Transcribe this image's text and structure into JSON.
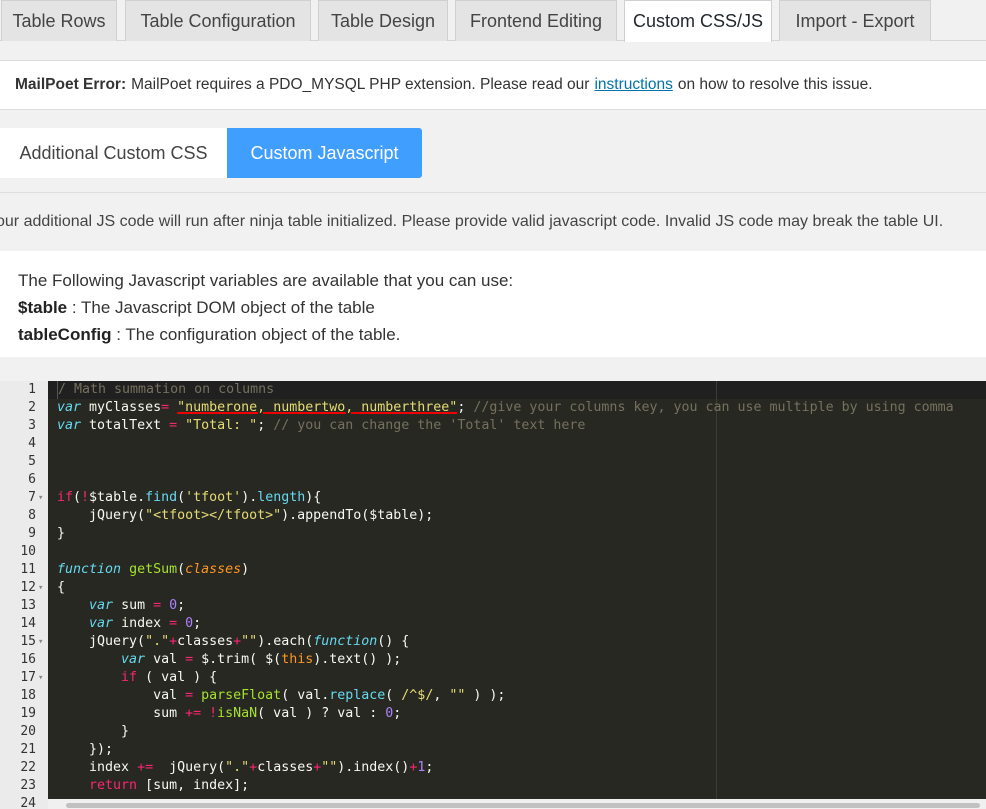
{
  "tabs": [
    {
      "label": "Table Rows",
      "active": false
    },
    {
      "label": "Table Configuration",
      "active": false
    },
    {
      "label": "Table Design",
      "active": false
    },
    {
      "label": "Frontend Editing",
      "active": false
    },
    {
      "label": "Custom CSS/JS",
      "active": true
    },
    {
      "label": "Import - Export",
      "active": false
    }
  ],
  "notice": {
    "title": "MailPoet Error:",
    "text_before": "MailPoet requires a PDO_MYSQL PHP extension. Please read our",
    "link": "instructions",
    "text_after": "on how to resolve this issue."
  },
  "subtabs": {
    "css": "Additional Custom CSS",
    "js": "Custom Javascript"
  },
  "js_info": "our additional JS code will run after ninja table initialized. Please provide valid javascript code. Invalid JS code may break the table UI.",
  "variables": {
    "intro": "The Following Javascript variables are available that you can use:",
    "var1_name": "$table",
    "var1_desc": " : The Javascript DOM object of the table",
    "var2_name": "tableConfig",
    "var2_desc": " : The configuration object of the table."
  },
  "editor": {
    "line_numbers": [
      "1",
      "2",
      "3",
      "4",
      "5",
      "6",
      "7",
      "8",
      "9",
      "10",
      "11",
      "12",
      "13",
      "14",
      "15",
      "16",
      "17",
      "18",
      "19",
      "20",
      "21",
      "22",
      "23",
      "24"
    ],
    "fold_lines": [
      7,
      12,
      15,
      17
    ]
  }
}
